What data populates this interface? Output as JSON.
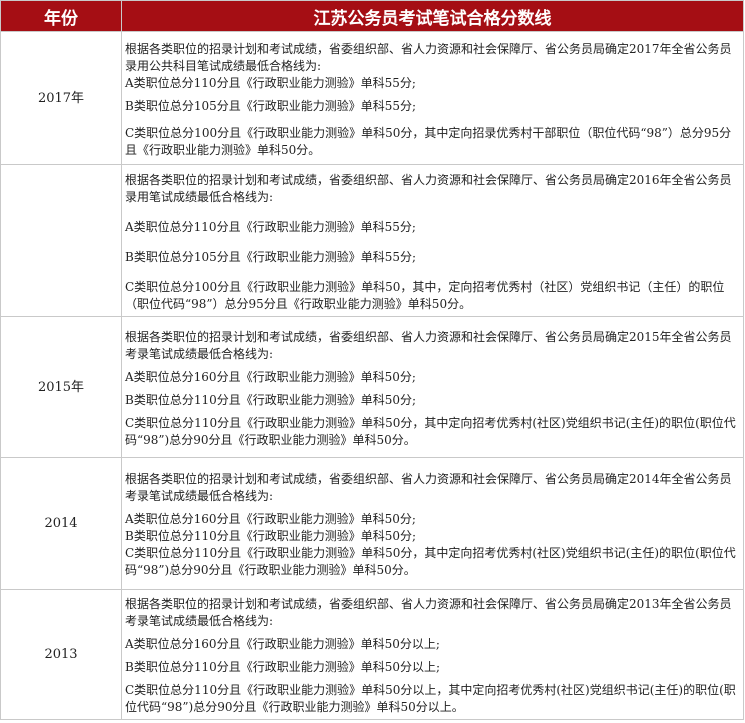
{
  "header": {
    "year": "年份",
    "title": "江苏公务员考试笔试合格分数线"
  },
  "rows": [
    {
      "year": "2017年",
      "intro": "根据各类职位的招录计划和考试成绩，省委组织部、省人力资源和社会保障厅、省公务员局确定2017年全省公务员录用公共科目笔试成绩最低合格线为:",
      "a": "A类职位总分110分且《行政职业能力测验》单科55分;",
      "b": "B类职位总分105分且《行政职业能力测验》单科55分;",
      "c": "C类职位总分100分且《行政职业能力测验》单科50分，其中定向招录优秀村干部职位（职位代码“98”）总分95分且《行政职业能力测验》单科50分。"
    },
    {
      "year": "",
      "intro": "根据各类职位的招录计划和考试成绩，省委组织部、省人力资源和社会保障厅、省公务员局确定2016年全省公务员录用笔试成绩最低合格线为:",
      "a": "A类职位总分110分且《行政职业能力测验》单科55分;",
      "b": "B类职位总分105分且《行政职业能力测验》单科55分;",
      "c": "C类职位总分100分且《行政职业能力测验》单科50，其中，定向招考优秀村（社区）党组织书记（主任）的职位（职位代码“98”）总分95分且《行政职业能力测验》单科50分。"
    },
    {
      "year": "2015年",
      "intro": "根据各类职位的招录计划和考试成绩，省委组织部、省人力资源和社会保障厅、省公务员局确定2015年全省公务员考录笔试成绩最低合格线为:",
      "a": "A类职位总分160分且《行政职业能力测验》单科50分;",
      "b": "B类职位总分110分且《行政职业能力测验》单科50分;",
      "c": "C类职位总分110分且《行政职业能力测验》单科50分，其中定向招考优秀村(社区)党组织书记(主任)的职位(职位代码“98”)总分90分且《行政职业能力测验》单科50分。"
    },
    {
      "year": "2014",
      "intro": "根据各类职位的招录计划和考试成绩，省委组织部、省人力资源和社会保障厅、省公务员局确定2014年全省公务员考录笔试成绩最低合格线为:",
      "a": "A类职位总分160分且《行政职业能力测验》单科50分;",
      "b": "B类职位总分110分且《行政职业能力测验》单科50分;",
      "c": "C类职位总分110分且《行政职业能力测验》单科50分，其中定向招考优秀村(社区)党组织书记(主任)的职位(职位代码“98”)总分90分且《行政职业能力测验》单科50分。"
    },
    {
      "year": "2013",
      "intro": "根据各类职位的招录计划和考试成绩，省委组织部、省人力资源和社会保障厅、省公务员局确定2013年全省公务员考录笔试成绩最低合格线为:",
      "a": "A类职位总分160分且《行政职业能力测验》单科50分以上;",
      "b": "B类职位总分110分且《行政职业能力测验》单科50分以上;",
      "c": "C类职位总分110分且《行政职业能力测验》单科50分以上，其中定向招考优秀村(社区)党组织书记(主任)的职位(职位代码“98”)总分90分且《行政职业能力测验》单科50分以上。"
    }
  ]
}
